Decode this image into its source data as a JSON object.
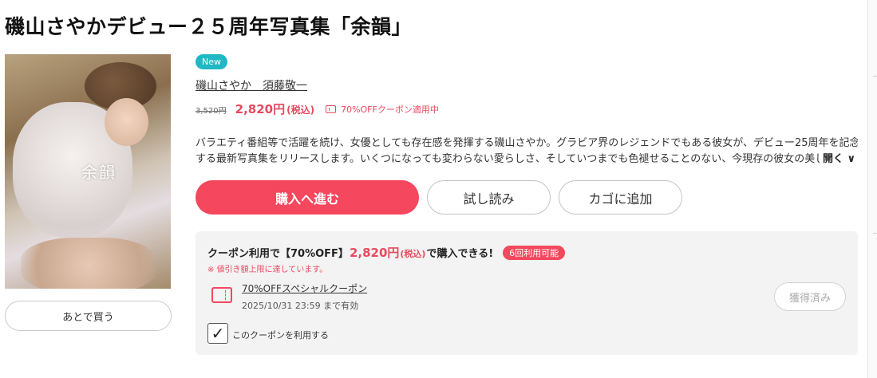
{
  "product": {
    "title": "磯山さやかデビュー２５周年写真集「余韻」",
    "cover_title": "余韻",
    "badge": "New",
    "authors": "磯山さやか　須藤敬一",
    "original_price": "3,520円",
    "sale_price": "2,820円",
    "tax_label": "(税込)",
    "coupon_note": "70%OFFクーポン適用中",
    "description_line1": "バラエティ番組等で活躍を続け、女優としても存在感を発揮する磯山さやか。グラビア界のレジェンドでもある彼女が、デビュー25周年を記念",
    "description_line2": "する最新写真集をリリースします。いくつになっても変わらない愛らしさ、そしていつまでも色褪せることのない、今現存の彼女の美しさ",
    "more_label": "開く ∨"
  },
  "actions": {
    "buy": "購入へ進む",
    "trial": "試し読み",
    "cart": "カゴに追加",
    "later": "あとで買う"
  },
  "coupon": {
    "head_prefix": "クーポン利用で【70%OFF】",
    "price": "2,820円",
    "tax": "(税込)",
    "head_suffix": "で購入できる!",
    "times_badge": "6回利用可能",
    "warning": "※ 値引き額上限に達しています。",
    "name": "70%OFFスペシャルクーポン",
    "expiry": "2025/10/31 23:59 まで有効",
    "acquired_label": "獲得済み",
    "use_checkbox_label": "このクーポンを利用する",
    "use_checked": true
  },
  "colors": {
    "accent": "#f5475d",
    "price": "#e84a5f",
    "new_badge": "#1fb8c4"
  }
}
